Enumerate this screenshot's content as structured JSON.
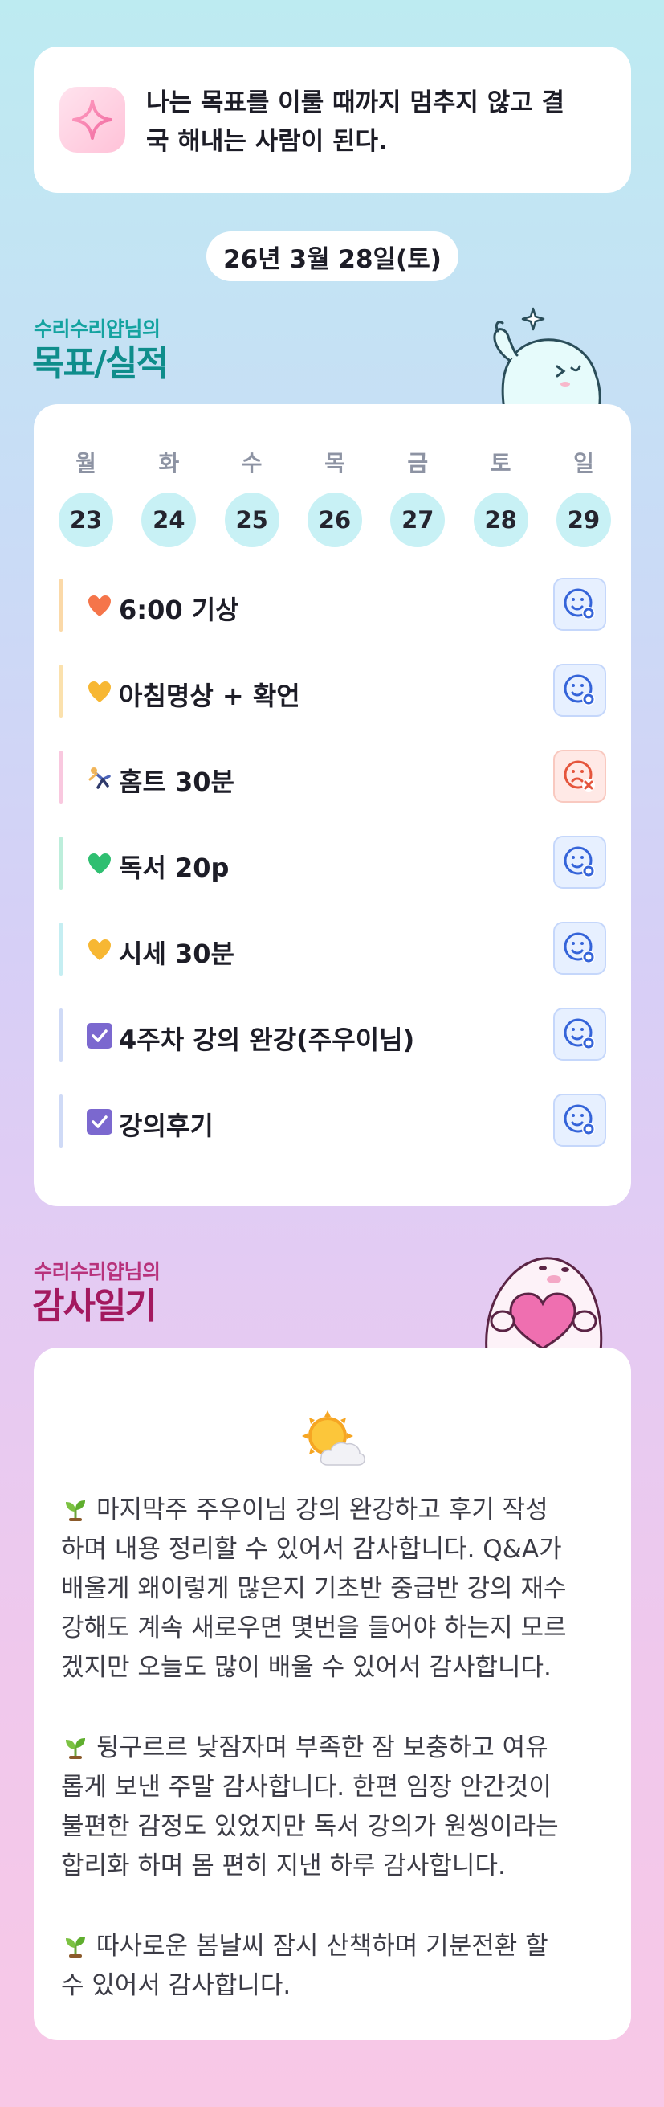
{
  "affirmation": {
    "icon": "sparkle-icon",
    "line1": "나는 목표를 이룰 때까지 멈추지 않고 결",
    "line2": "국 해내는 사람이 된다."
  },
  "date_label": "26년 3월 28일(토)",
  "goals_section": {
    "subtitle": "수리수리얍님의",
    "title": "목표/실적",
    "subtitle_color": "#14a3a0",
    "title_color": "#0e8d8b"
  },
  "week": [
    {
      "day": "월",
      "date": "23"
    },
    {
      "day": "화",
      "date": "24"
    },
    {
      "day": "수",
      "date": "25"
    },
    {
      "day": "목",
      "date": "26"
    },
    {
      "day": "금",
      "date": "27"
    },
    {
      "day": "토",
      "date": "28"
    },
    {
      "day": "일",
      "date": "29"
    }
  ],
  "goals": [
    {
      "emoji": "🧡",
      "label": "6:00 기상",
      "bar_color": "#fbd9a8",
      "status": "done"
    },
    {
      "emoji": "💛",
      "label": "아침명상 + 확언",
      "bar_color": "#fbe1ad",
      "status": "done"
    },
    {
      "emoji": "🤸",
      "label": "홈트 30분",
      "bar_color": "#f9c8df",
      "status": "failed"
    },
    {
      "emoji": "💚",
      "label": "독서 20p",
      "bar_color": "#bdeedb",
      "status": "done"
    },
    {
      "emoji": "💛",
      "label": "시세 30분",
      "bar_color": "#c5eef2",
      "status": "done"
    },
    {
      "emoji": "✅",
      "label": "4주차 강의 완강(주우이님)",
      "bar_color": "#cfdaf6",
      "status": "done"
    },
    {
      "emoji": "✅",
      "label": "강의후기",
      "bar_color": "#cfdaf6",
      "status": "done"
    }
  ],
  "gratitude_section": {
    "subtitle": "수리수리얍님의",
    "title": "감사일기",
    "subtitle_color": "#b8337c",
    "title_color": "#a3195f"
  },
  "gratitude": {
    "weather_icon": "sun-behind-cloud-icon",
    "entries": [
      {
        "icon": "seedling-icon",
        "lines": [
          "마지막주 주우이님 강의 완강하고 후기 작성",
          "하며 내용 정리할 수 있어서 감사합니다. Q&A가",
          "배울게 왜이렇게 많은지 기초반 중급반 강의 재수",
          "강해도 계속 새로우면 몇번을 들어야 하는지 모르",
          "겠지만 오늘도 많이 배울 수 있어서 감사합니다."
        ]
      },
      {
        "icon": "seedling-icon",
        "lines": [
          "뒹구르르 낮잠자며 부족한 잠 보충하고 여유",
          "롭게 보낸 주말 감사합니다. 한편 임장 안간것이",
          "불편한 감정도 있었지만 독서 강의가 원씽이라는",
          "합리화 하며 몸 편히 지낸 하루 감사합니다."
        ]
      },
      {
        "icon": "seedling-icon",
        "lines": [
          "따사로운 봄날씨 잠시 산책하며 기분전환 할",
          "수 있어서 감사합니다."
        ]
      }
    ]
  }
}
